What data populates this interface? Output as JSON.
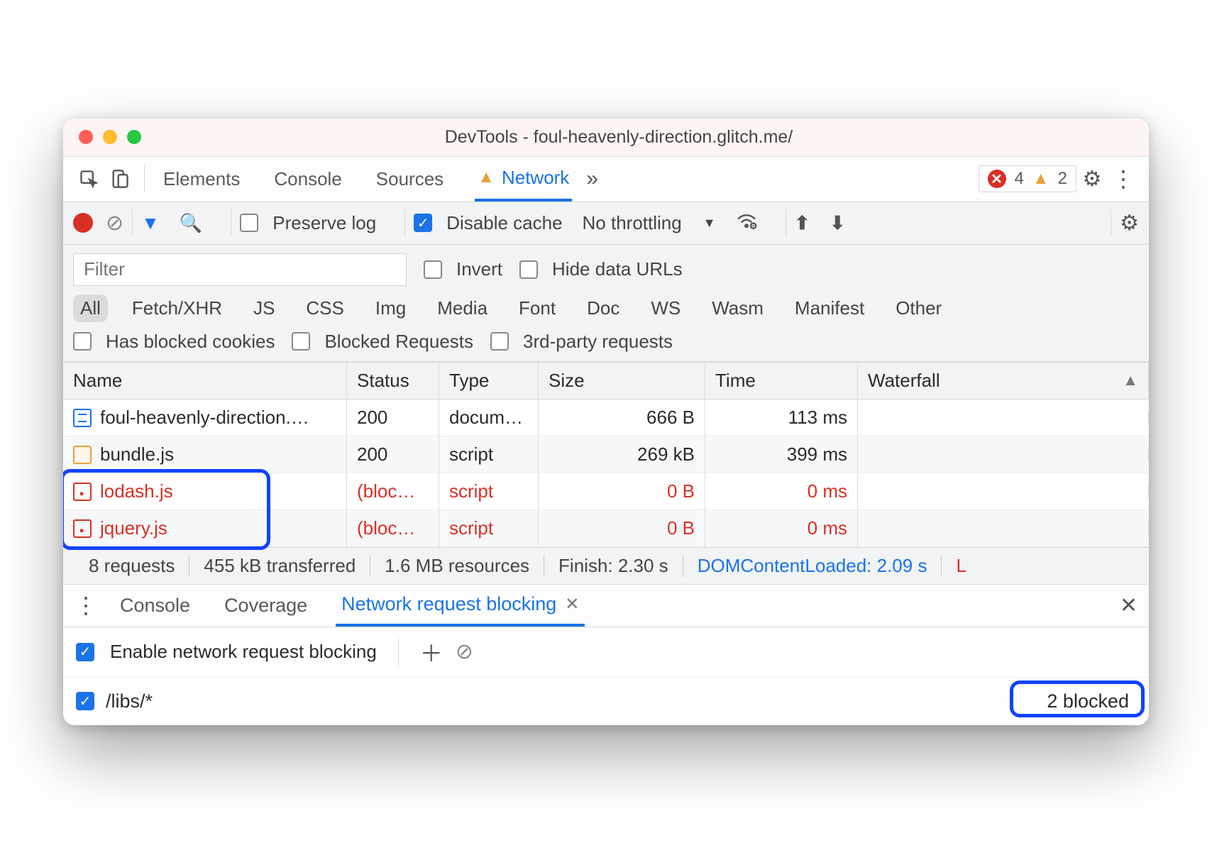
{
  "window": {
    "title": "DevTools - foul-heavenly-direction.glitch.me/"
  },
  "tabs": {
    "items": [
      "Elements",
      "Console",
      "Sources",
      "Network"
    ],
    "active": "Network",
    "error_count": "4",
    "warn_count": "2"
  },
  "toolbar": {
    "preserve_log": "Preserve log",
    "disable_cache": "Disable cache",
    "throttling": "No throttling"
  },
  "filters": {
    "placeholder": "Filter",
    "invert": "Invert",
    "hide_data_urls": "Hide data URLs",
    "types": [
      "All",
      "Fetch/XHR",
      "JS",
      "CSS",
      "Img",
      "Media",
      "Font",
      "Doc",
      "WS",
      "Wasm",
      "Manifest",
      "Other"
    ],
    "active_type": "All",
    "has_blocked_cookies": "Has blocked cookies",
    "blocked_requests": "Blocked Requests",
    "third_party": "3rd-party requests"
  },
  "columns": [
    "Name",
    "Status",
    "Type",
    "Size",
    "Time",
    "Waterfall"
  ],
  "rows": [
    {
      "name": "foul-heavenly-direction.…",
      "status": "200",
      "type": "docum…",
      "size": "666 B",
      "time": "113 ms",
      "blocked": false,
      "icon": "doc"
    },
    {
      "name": "bundle.js",
      "status": "200",
      "type": "script",
      "size": "269 kB",
      "time": "399 ms",
      "blocked": false,
      "icon": "js"
    },
    {
      "name": "lodash.js",
      "status": "(bloc…",
      "type": "script",
      "size": "0 B",
      "time": "0 ms",
      "blocked": true,
      "icon": "blk"
    },
    {
      "name": "jquery.js",
      "status": "(bloc…",
      "type": "script",
      "size": "0 B",
      "time": "0 ms",
      "blocked": true,
      "icon": "blk"
    }
  ],
  "summary": {
    "requests": "8 requests",
    "transferred": "455 kB transferred",
    "resources": "1.6 MB resources",
    "finish": "Finish: 2.30 s",
    "dcl": "DOMContentLoaded: 2.09 s",
    "load": "L"
  },
  "drawer": {
    "tabs": [
      "Console",
      "Coverage",
      "Network request blocking"
    ],
    "active": "Network request blocking",
    "enable_label": "Enable network request blocking",
    "patterns": [
      {
        "pattern": "/libs/*",
        "count": "2 blocked"
      }
    ]
  }
}
